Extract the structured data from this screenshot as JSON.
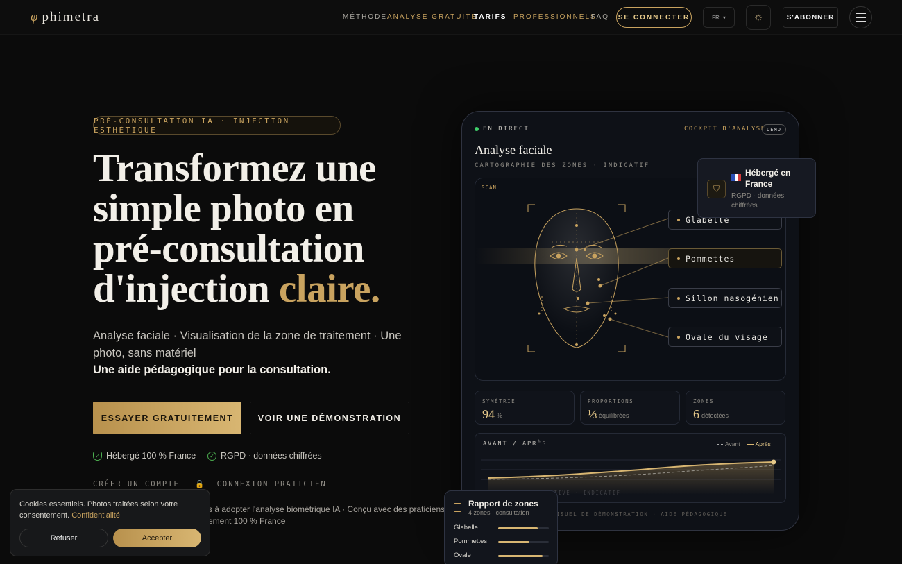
{
  "header": {
    "logo_symbol": "φ",
    "logo_text": "phimetra",
    "nav": [
      {
        "label": "MÉTHODE",
        "color": "#a8a59e"
      },
      {
        "label": "ANALYSE GRATUITE",
        "color": "#c9a35f"
      },
      {
        "label": "TARIFS",
        "color": "#ffffff"
      },
      {
        "label": "PROFESSIONNELS",
        "color": "#c9a35f"
      },
      {
        "label": "FAQ",
        "color": "#a8a59e"
      }
    ],
    "login_label": "SE CONNECTER",
    "lang": "FR",
    "lang_caret": "▾",
    "theme_icon": "☼",
    "subscribe_label": "S'ABONNER"
  },
  "hero": {
    "tag": "PRÉ-CONSULTATION IA · INJECTION ESTHÉTIQUE",
    "title_line1": "Transformez une",
    "title_line2": "simple photo en",
    "title_line3": "pré-consultation",
    "title_line4_main": "d'injection",
    "title_line4_accent": "claire.",
    "lead": "Analyse faciale · Visualisation de la zone de traitement · Une photo, sans matériel",
    "lead_bold": "Une aide pédagogique pour la consultation.",
    "cta_primary": "ESSAYER GRATUITEMENT",
    "cta_secondary": "VOIR UNE DÉMONSTRATION",
    "trust1": "Hébergé 100 % France",
    "trust2": "RGPD · données chiffrées",
    "link_create": "CRÉER UN COMPTE",
    "link_login": "CONNEXION PRATICIEN",
    "bottom_line1": "s à adopter l'analyse biométrique IA · Conçu avec des praticiens",
    "bottom_line2": "ement 100 % France"
  },
  "cookie": {
    "text": "Cookies essentiels. Photos traitées selon votre consentement.",
    "link": "Confidentialité",
    "refuse": "Refuser",
    "accept": "Accepter"
  },
  "cockpit": {
    "live": "EN DIRECT",
    "label": "COCKPIT D'ANALYSE",
    "demo": "DEMO",
    "title": "Analyse faciale",
    "subtitle": "CARTOGRAPHIE DES ZONES · INDICATIF",
    "scan_label": "SCAN",
    "zones": [
      "Glabelle",
      "Pommettes",
      "Sillon nasogénien",
      "Ovale du visage"
    ],
    "stats": [
      {
        "label": "SYMÉTRIE",
        "value": "94",
        "unit": "%"
      },
      {
        "label": "PROPORTIONS",
        "value": "⅓",
        "unit": "équilibrées"
      },
      {
        "label": "ZONES",
        "value": "6",
        "unit": "détectées"
      }
    ],
    "chart_title": "AVANT / APRÈS",
    "legend_before": "Avant",
    "legend_after": "Après",
    "chart_caption": "PROJECTION INDICATIVE · INDICATIF",
    "footnote": "VISUEL DE DÉMONSTRATION · AIDE PÉDAGOGIQUE"
  },
  "hosted": {
    "title": "Hébergé en France",
    "subtitle": "RGPD · données chiffrées"
  },
  "report": {
    "title": "Rapport de zones",
    "subtitle": "4 zones · consultation",
    "rows": [
      {
        "label": "Glabelle",
        "level": 0.78
      },
      {
        "label": "Pommettes",
        "level": 0.62
      },
      {
        "label": "Ovale",
        "level": 0.88
      }
    ]
  },
  "colors": {
    "accent": "#c9a35f",
    "bg": "#0b0b0b",
    "live": "#3fcf6a"
  }
}
